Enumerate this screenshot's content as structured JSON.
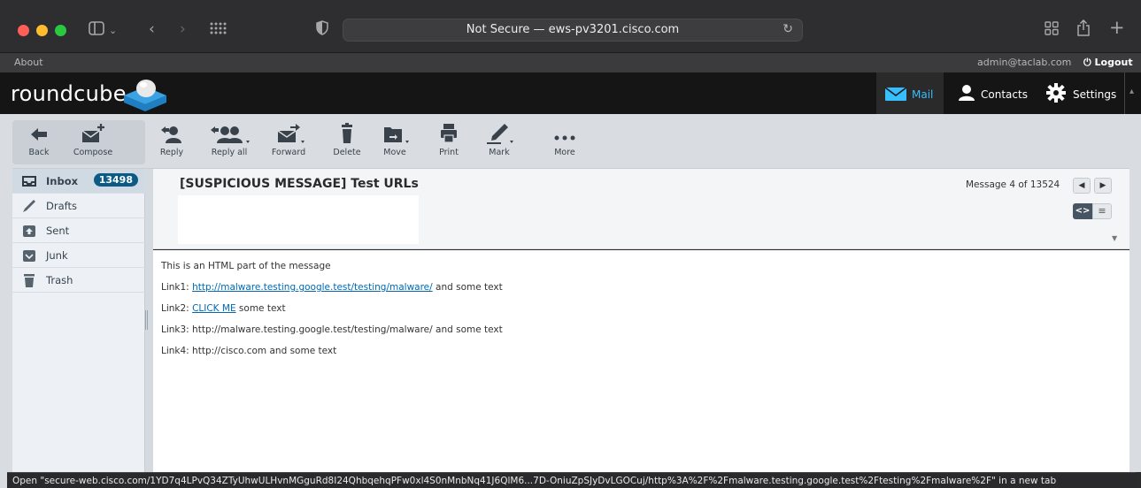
{
  "browser": {
    "url_text": "Not Secure — ews-pv3201.cisco.com",
    "traffic_colors": [
      "#ff5f57",
      "#febc2e",
      "#28c840"
    ]
  },
  "topline": {
    "about": "About",
    "user": "admin@taclab.com",
    "logout": "Logout"
  },
  "app": {
    "logo_text": "roundcube",
    "nav": {
      "mail": "Mail",
      "contacts": "Contacts",
      "settings": "Settings"
    }
  },
  "toolbar": {
    "back": "Back",
    "compose": "Compose",
    "reply": "Reply",
    "reply_all": "Reply all",
    "forward": "Forward",
    "delete": "Delete",
    "move": "Move",
    "print": "Print",
    "mark": "Mark",
    "more": "More"
  },
  "folders": [
    {
      "label": "Inbox",
      "badge": "13498",
      "icon": "inbox-icon"
    },
    {
      "label": "Drafts",
      "icon": "pencil-icon"
    },
    {
      "label": "Sent",
      "icon": "sent-icon"
    },
    {
      "label": "Junk",
      "icon": "junk-icon"
    },
    {
      "label": "Trash",
      "icon": "trash-icon"
    }
  ],
  "message": {
    "subject": "[SUSPICIOUS MESSAGE] Test URLs",
    "counter": "Message 4 of 13524",
    "line1": "This is an HTML part of the message",
    "line2_prefix": "Link1: ",
    "line2_link": "http://malware.testing.google.test/testing/malware/",
    "line2_suffix": " and some text",
    "line3_prefix": "Link2: ",
    "line3_link": "CLICK ME",
    "line3_suffix": " some text",
    "line4": "Link3: http://malware.testing.google.test/testing/malware/ and some text",
    "line5": "Link4: http://cisco.com and some text"
  },
  "status_bar": "Open \"secure-web.cisco.com/1YD7q4LPvQ34ZTyUhwULHvnMGguRd8I24QhbqehqPFw0xl4S0nMnbNq41J6QlM6...7D-OniuZpSJyDvLGOCuj/http%3A%2F%2Fmalware.testing.google.test%2Ftesting%2Fmalware%2F\" in a new tab",
  "colors": {
    "accent": "#37beff",
    "badge_bg": "#0b5b86",
    "link": "#0168b3"
  }
}
